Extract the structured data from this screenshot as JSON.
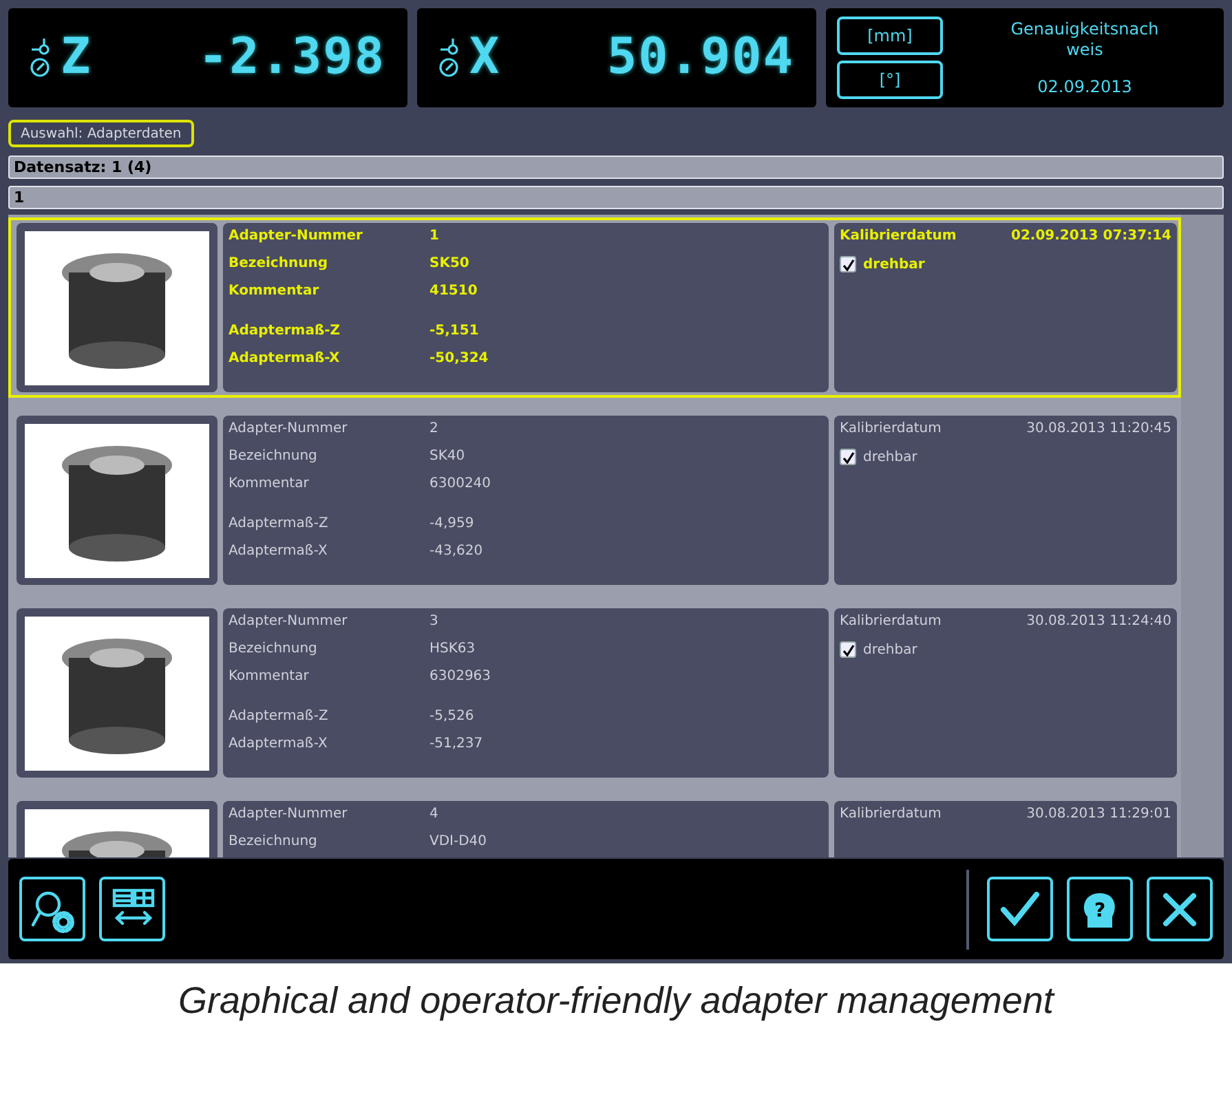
{
  "dro": [
    {
      "axis": "Z",
      "value": "-2.398"
    },
    {
      "axis": "X",
      "value": "50.904"
    }
  ],
  "units": [
    {
      "label": "[mm]"
    },
    {
      "label": "[°]"
    }
  ],
  "info": {
    "title": "Genauigkeitsnachweis",
    "date": "02.09.2013"
  },
  "selection": "Auswahl: Adapterdaten",
  "record": "Datensatz: 1 (4)",
  "record_filter": "1",
  "adapters": [
    {
      "selected": true,
      "fields": [
        {
          "label": "Adapter-Nummer",
          "value": "1"
        },
        {
          "label": "Bezeichnung",
          "value": "SK50"
        },
        {
          "label": "Kommentar",
          "value": "41510"
        }
      ],
      "measures": [
        {
          "label": "Adaptermaß-Z",
          "value": "-5,151"
        },
        {
          "label": "Adaptermaß-X",
          "value": "-50,324"
        }
      ],
      "calibration": {
        "label": "Kalibrierdatum",
        "value": "02.09.2013 07:37:14"
      },
      "rotatable": {
        "label": "drehbar",
        "checked": true
      }
    },
    {
      "selected": false,
      "fields": [
        {
          "label": "Adapter-Nummer",
          "value": "2"
        },
        {
          "label": "Bezeichnung",
          "value": "SK40"
        },
        {
          "label": "Kommentar",
          "value": "6300240"
        }
      ],
      "measures": [
        {
          "label": "Adaptermaß-Z",
          "value": "-4,959"
        },
        {
          "label": "Adaptermaß-X",
          "value": "-43,620"
        }
      ],
      "calibration": {
        "label": "Kalibrierdatum",
        "value": "30.08.2013 11:20:45"
      },
      "rotatable": {
        "label": "drehbar",
        "checked": true
      }
    },
    {
      "selected": false,
      "fields": [
        {
          "label": "Adapter-Nummer",
          "value": "3"
        },
        {
          "label": "Bezeichnung",
          "value": "HSK63"
        },
        {
          "label": "Kommentar",
          "value": "6302963"
        }
      ],
      "measures": [
        {
          "label": "Adaptermaß-Z",
          "value": "-5,526"
        },
        {
          "label": "Adaptermaß-X",
          "value": "-51,237"
        }
      ],
      "calibration": {
        "label": "Kalibrierdatum",
        "value": "30.08.2013 11:24:40"
      },
      "rotatable": {
        "label": "drehbar",
        "checked": true
      }
    },
    {
      "selected": false,
      "fields": [
        {
          "label": "Adapter-Nummer",
          "value": "4"
        },
        {
          "label": "Bezeichnung",
          "value": "VDI-D40"
        }
      ],
      "calibration": {
        "label": "Kalibrierdatum",
        "value": "30.08.2013 11:29:01"
      }
    }
  ],
  "toolbar": {
    "left": [
      {
        "kind": "search-settings"
      },
      {
        "kind": "layout-swap"
      }
    ],
    "right": [
      {
        "kind": "confirm"
      },
      {
        "kind": "help",
        "glyph": "?"
      },
      {
        "kind": "cancel"
      }
    ]
  },
  "caption": "Graphical and operator-friendly adapter management"
}
